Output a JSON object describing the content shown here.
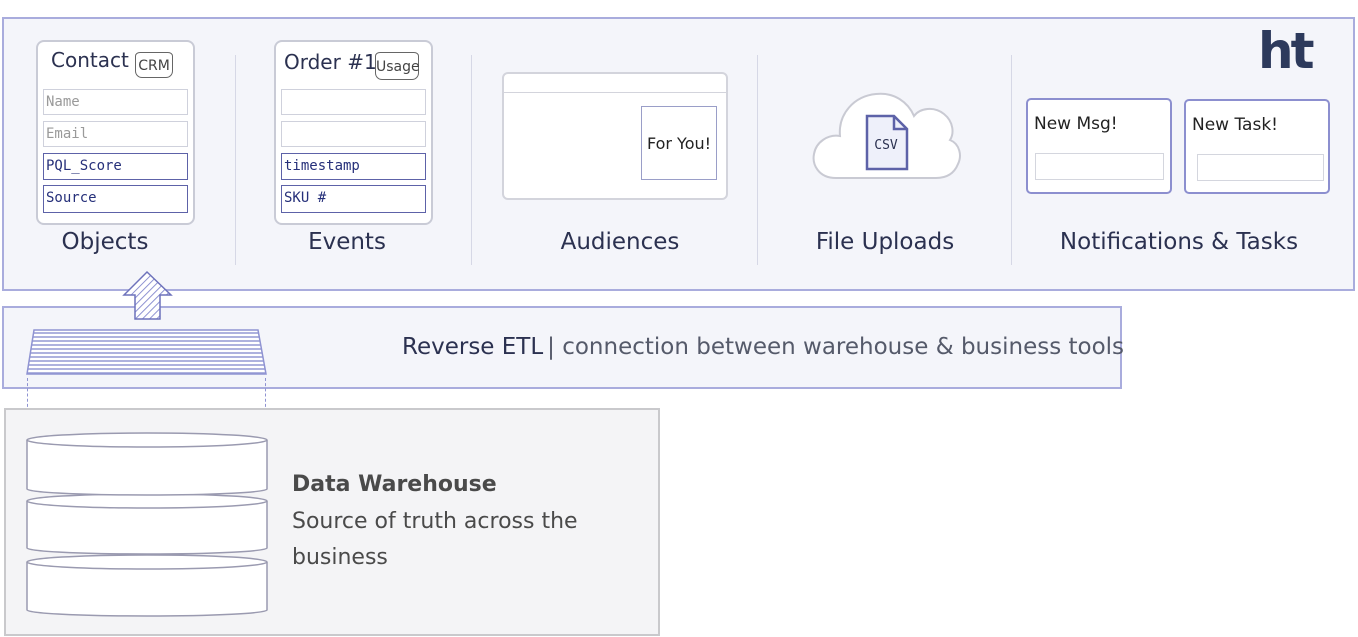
{
  "logo": "ht",
  "columns": [
    {
      "label": "Objects"
    },
    {
      "label": "Events"
    },
    {
      "label": "Audiences"
    },
    {
      "label": "File Uploads"
    },
    {
      "label": "Notifications & Tasks"
    }
  ],
  "objects_card": {
    "title": "Contact",
    "tag": "CRM",
    "fields": [
      "Name",
      "Email",
      "PQL_Score",
      "Source"
    ]
  },
  "events_card": {
    "title": "Order #1",
    "tag": "Usage",
    "fields": [
      "",
      "",
      "timestamp",
      "SKU #"
    ]
  },
  "audiences": {
    "banner": "For You!"
  },
  "file_uploads": {
    "file_label": "CSV"
  },
  "notifications": [
    {
      "title": "New Msg!"
    },
    {
      "title": "New Task!"
    }
  ],
  "etl": {
    "title": "Reverse ETL",
    "separator": "|",
    "description": " connection between warehouse & business tools"
  },
  "warehouse": {
    "title": "Data Warehouse",
    "description": "Source of truth across the business"
  },
  "colors": {
    "accent": "#a9acdd",
    "navy": "#2b3150",
    "panel": "#f4f5fa"
  }
}
